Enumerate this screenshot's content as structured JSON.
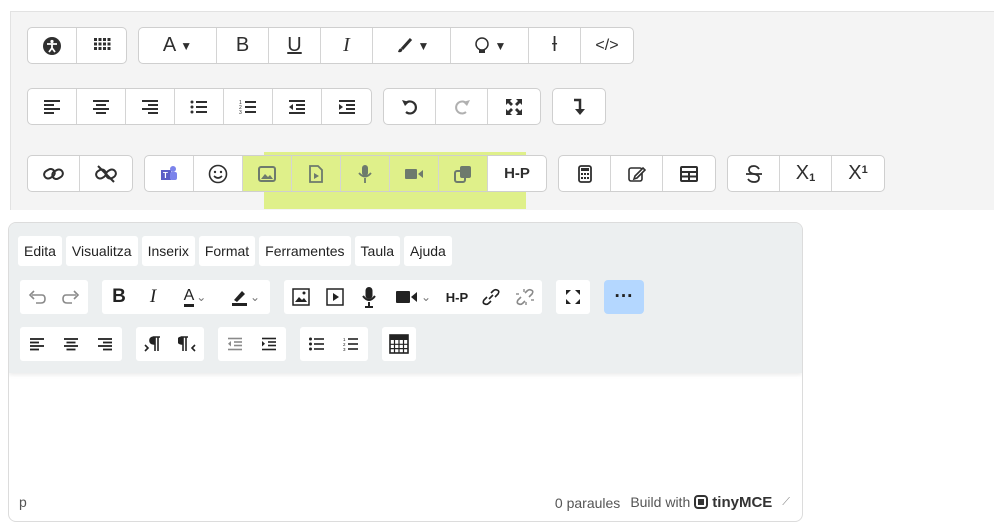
{
  "atto": {
    "row1": [
      [
        "accessibility-icon",
        "apps-grid-icon"
      ],
      [
        "A▾",
        "B",
        "U",
        "I",
        "🖌▾",
        "♀▾",
        "Ɨ",
        "</>"
      ]
    ],
    "row2": [
      [
        "≡",
        "≡",
        "≡",
        "☰",
        "☷",
        "⇤",
        "⇥"
      ],
      [
        "↶",
        "↷",
        "✕"
      ],
      [
        "↴"
      ]
    ],
    "row3": [
      [
        "🔗",
        "⛓"
      ],
      [
        "teams-icon",
        "☺",
        "image-icon",
        "file-icon",
        "mic-icon",
        "video-icon",
        "copy-icon",
        "H-P"
      ],
      [
        "calculator-icon",
        "edit-icon",
        "table-icon"
      ],
      [
        "S",
        "X₁",
        "X¹"
      ]
    ]
  },
  "tiny": {
    "menubar": [
      "Edita",
      "Visualitza",
      "Inserix",
      "Format",
      "Ferramentes",
      "Taula",
      "Ajuda"
    ],
    "toolbar1": {
      "undo": "↶",
      "redo": "↷",
      "bold": "B",
      "italic": "I",
      "forecolor": "A",
      "highlight": "✎",
      "image": "▣",
      "media": "▶",
      "mic": "🎙",
      "video": "■◀",
      "h5p": "H-P",
      "link": "🔗",
      "unlink": "⛓",
      "fullscreen": "⛶",
      "more": "···"
    },
    "toolbar2": {
      "align_left": "≡",
      "align_center": "≡",
      "align_right": "≡",
      "ltr": "¶",
      "rtl": "¶",
      "outdent": "⇤",
      "indent": "⇥",
      "bullist": "☰",
      "numlist": "☷",
      "calc": "▦"
    },
    "status": {
      "path": "p",
      "word_count": "0 paraules",
      "build_with": "Build with",
      "brand": "tinyMCE"
    }
  }
}
